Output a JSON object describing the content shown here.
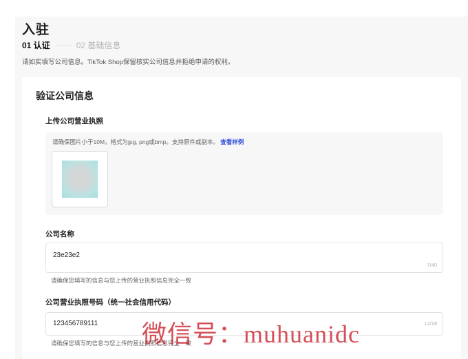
{
  "page": {
    "title": "入驻",
    "steps": {
      "current": "01 认证",
      "next": "02 基础信息"
    },
    "subtitle": "请如实填写公司信息。TikTok Shop保留核实公司信息并拒绝申请的权利。"
  },
  "card": {
    "title": "验证公司信息",
    "license_upload": {
      "label": "上传公司营业执照",
      "hint": "请确保图片小于10M，格式为jpg, png或bmp。支持原件或副本。",
      "example_link": "查看样例"
    },
    "company_name": {
      "label": "公司名称",
      "value": "23e23e2",
      "counter": "7/40",
      "helper": "请确保您填写的信息与您上传的营业执照信息完全一致"
    },
    "license_number": {
      "label": "公司营业执照号码（统一社会信用代码）",
      "value": "123456789111",
      "counter": "12/18",
      "helper": "请确保您填写的信息与您上传的营业执照信息完全一致"
    }
  },
  "watermark": "微信号：muhuanidc",
  "colors": {
    "link": "#2f4fd8",
    "background": "#f7f7f8",
    "watermark": "#c81e28"
  }
}
